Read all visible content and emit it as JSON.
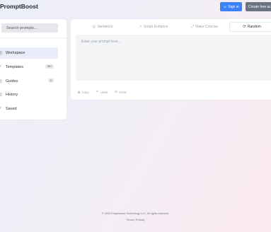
{
  "app": {
    "brand": "PromptBoost"
  },
  "header": {
    "signin_icon": "user-icon",
    "signin_label": "Sign in",
    "create_label": "Create free ac"
  },
  "sidebar": {
    "search_placeholder": "Search prompts...",
    "items": [
      {
        "label": "Workspace",
        "icon": "▯"
      },
      {
        "label": "Templates",
        "icon": "⁄",
        "badge": "99+"
      },
      {
        "label": "Guides",
        "icon": "▯",
        "badge": "6"
      },
      {
        "label": "History",
        "icon": "▯"
      },
      {
        "label": "Saved",
        "icon": "⁄"
      }
    ]
  },
  "tabs": [
    {
      "label": "Variations",
      "icon": "◎"
    },
    {
      "label": "Smart Enhance",
      "icon": "✧"
    },
    {
      "label": "Make Concise",
      "icon": "⤢"
    },
    {
      "label": "Random",
      "icon": "⟳"
    }
  ],
  "editor": {
    "placeholder": "Enter your prompt here..."
  },
  "actions": [
    {
      "label": "Copy",
      "icon": "⧉"
    },
    {
      "label": "Undo",
      "icon": "↶"
    },
    {
      "label": "Clear",
      "icon": "⊘"
    }
  ],
  "footer": {
    "copyright": "© 2025 Empowered Technology LLC. All rights reserved.",
    "links": "Terms | Privacy"
  }
}
